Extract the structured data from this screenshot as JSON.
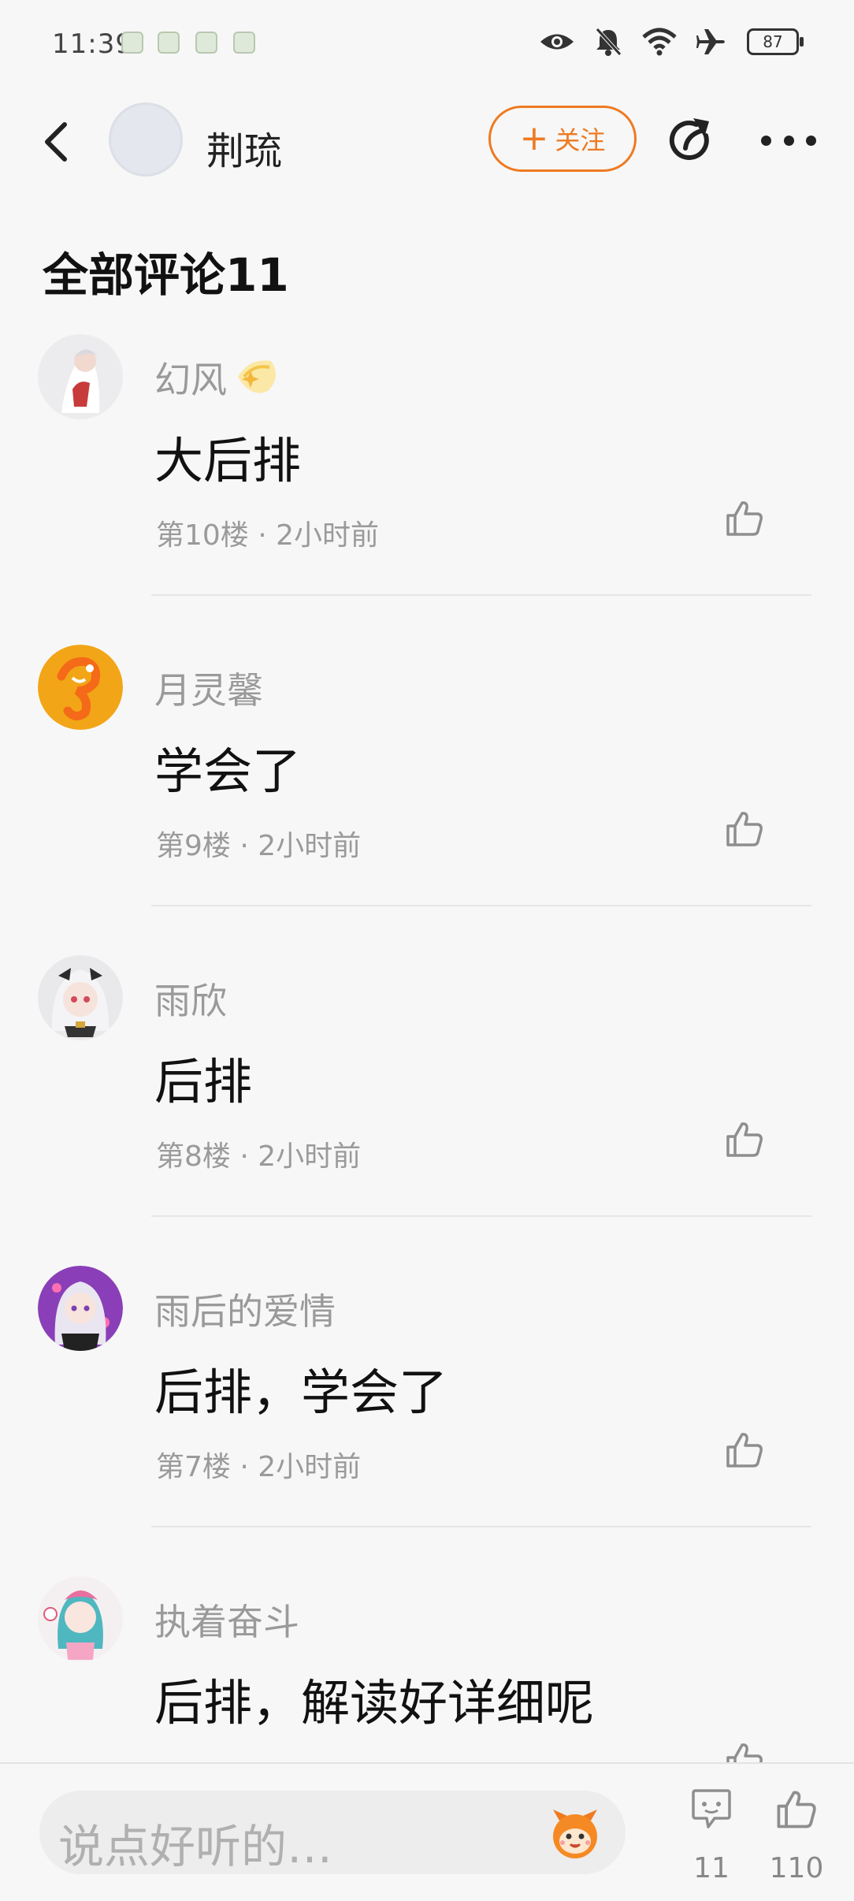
{
  "status_bar": {
    "time": "11:39",
    "battery": "87"
  },
  "header": {
    "username": "荆琉",
    "follow_label": "关注"
  },
  "section": {
    "title": "全部评论11"
  },
  "comments": [
    {
      "user": "幻风",
      "text": "大后排",
      "floor": "第10楼 · 2小时前"
    },
    {
      "user": "月灵馨",
      "text": "学会了",
      "floor": "第9楼 · 2小时前"
    },
    {
      "user": "雨欣",
      "text": "后排",
      "floor": "第8楼 · 2小时前"
    },
    {
      "user": "雨后的爱情",
      "text": "后排，学会了",
      "floor": "第7楼 · 2小时前"
    },
    {
      "user": "执着奋斗",
      "text": "后排，解读好详细呢",
      "floor": ""
    }
  ],
  "bottom_bar": {
    "placeholder": "说点好听的…",
    "comment_count": "11",
    "like_count": "110"
  },
  "colors": {
    "accent": "#ee7a22",
    "background": "#f7f7f7",
    "secondary_text": "#9a9a9a"
  }
}
